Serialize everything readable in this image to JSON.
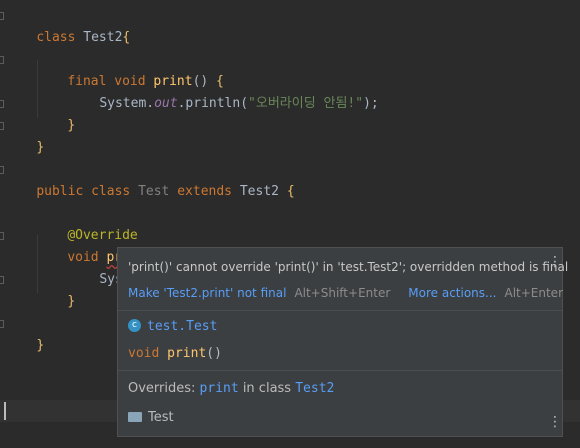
{
  "editor": {
    "line1": {
      "kw": "class",
      "name": "Test2",
      "brace": "{"
    },
    "line3": {
      "kw1": "final",
      "kw2": "void",
      "method": "print",
      "parens": "()",
      "brace": "{"
    },
    "line4": {
      "obj": "System.",
      "field": "out",
      "call": ".println(",
      "str": "\"오버라이딩 안됨!\"",
      "end": ");"
    },
    "line5": {
      "brace": "}"
    },
    "line6": {
      "brace": "}"
    },
    "line8": {
      "kw1": "public",
      "kw2": "class",
      "name": "Test",
      "kw3": "extends",
      "parent": "Test2",
      "brace": "{"
    },
    "line10": {
      "annotation": "@Override"
    },
    "line11": {
      "kw": "void",
      "method": "print",
      "parens": "()",
      "brace": "{"
    },
    "line12": {
      "text": "System"
    },
    "line13": {
      "brace": "}"
    },
    "line15": {
      "brace": "}"
    }
  },
  "popup": {
    "message": "'print()' cannot override 'print()' in 'test.Test2'; overridden method is final",
    "fix_label": "Make 'Test2.print' not final",
    "fix_shortcut": "Alt+Shift+Enter",
    "more_label": "More actions...",
    "more_shortcut": "Alt+Enter",
    "class_icon_letter": "c",
    "qualified_name": "test.Test",
    "sig_kw": "void",
    "sig_method": "print",
    "sig_parens": "()",
    "overrides_prefix": "Overrides: ",
    "overrides_method": "print",
    "overrides_mid": " in class ",
    "overrides_class": "Test2",
    "module": "Test",
    "kebab": "⋮"
  }
}
